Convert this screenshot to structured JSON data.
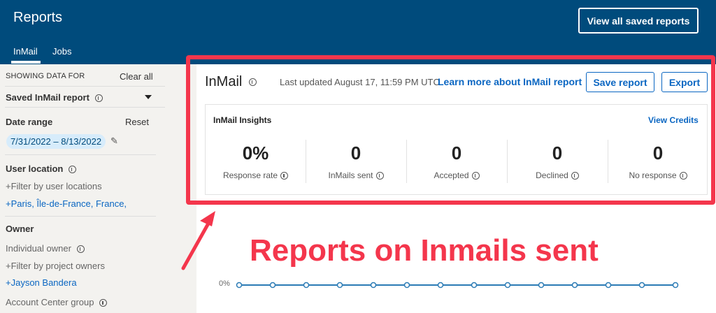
{
  "header": {
    "title": "Reports",
    "tabs": [
      {
        "label": "InMail"
      },
      {
        "label": "Jobs"
      }
    ],
    "view_all_label": "View all saved reports"
  },
  "sidebar": {
    "showing_data_for": "SHOWING DATA FOR",
    "clear_all": "Clear all",
    "saved_report": "Saved InMail report",
    "date_range_label": "Date range",
    "reset": "Reset",
    "date_range_value": "7/31/2022 – 8/13/2022",
    "user_location_label": "User location",
    "filter_locations": "Filter by user locations",
    "location_value": "+Paris, Île-de-France, France,",
    "owner_label": "Owner",
    "individual_owner": "Individual owner",
    "filter_owners": "Filter by project owners",
    "owner_value": "+Jayson Bandera",
    "account_center_group": "Account Center group"
  },
  "main": {
    "title": "InMail",
    "last_updated": "Last updated August 17, 11:59 PM UTC",
    "learn_more": "Learn more about InMail report",
    "save_report": "Save report",
    "export": "Export",
    "insights_title": "InMail Insights",
    "view_credits": "View Credits",
    "metrics": [
      {
        "value": "0%",
        "label": "Response rate"
      },
      {
        "value": "0",
        "label": "InMails sent"
      },
      {
        "value": "0",
        "label": "Accepted"
      },
      {
        "value": "0",
        "label": "Declined"
      },
      {
        "value": "0",
        "label": "No response"
      }
    ]
  },
  "annotation": {
    "text": "Reports on Inmails sent",
    "color": "#f4364c"
  },
  "chart_data": {
    "type": "line",
    "ytick": "0%",
    "values": [
      0,
      0,
      0,
      0,
      0,
      0,
      0,
      0,
      0,
      0,
      0,
      0,
      0,
      0
    ]
  },
  "colors": {
    "header_bg": "#004b7c",
    "accent": "#0a66c2",
    "highlight": "#f4364c",
    "line": "#2b7bb5"
  }
}
